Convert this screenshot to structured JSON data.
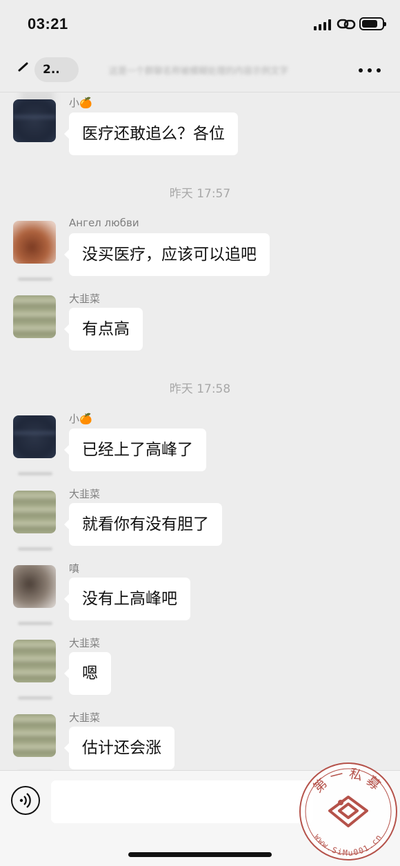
{
  "status_bar": {
    "time": "03:21"
  },
  "nav": {
    "back_text": "2..",
    "title": "这是一个群聊名称被模糊处理的内容示例文字"
  },
  "messages": [
    {
      "sender": "小🍊",
      "text": "医疗还敢追么？各位"
    },
    {
      "timestamp": "昨天 17:57"
    },
    {
      "sender": "Ангел любви",
      "text": "没买医疗，应该可以追吧"
    },
    {
      "sender": "大韭菜",
      "text": "有点高"
    },
    {
      "timestamp": "昨天 17:58"
    },
    {
      "sender": "小🍊",
      "text": "已经上了高峰了"
    },
    {
      "sender": "大韭菜",
      "text": "就看你有没有胆了"
    },
    {
      "sender": "嗔",
      "text": "没有上高峰吧"
    },
    {
      "sender": "大韭菜",
      "text": "嗯"
    },
    {
      "sender": "大韭菜",
      "text": "估计还会涨"
    }
  ],
  "input": {
    "placeholder": ""
  },
  "watermark": {
    "top_text": "第一私募",
    "url": "www.SiMu001.cn"
  },
  "colors": {
    "background": "#ededed",
    "bubble": "#ffffff",
    "seal_red": "#b5524a"
  },
  "icons": [
    "back-chevron-icon",
    "more-dots-icon",
    "voice-icon",
    "signal-icon",
    "link-icon",
    "battery-icon"
  ]
}
